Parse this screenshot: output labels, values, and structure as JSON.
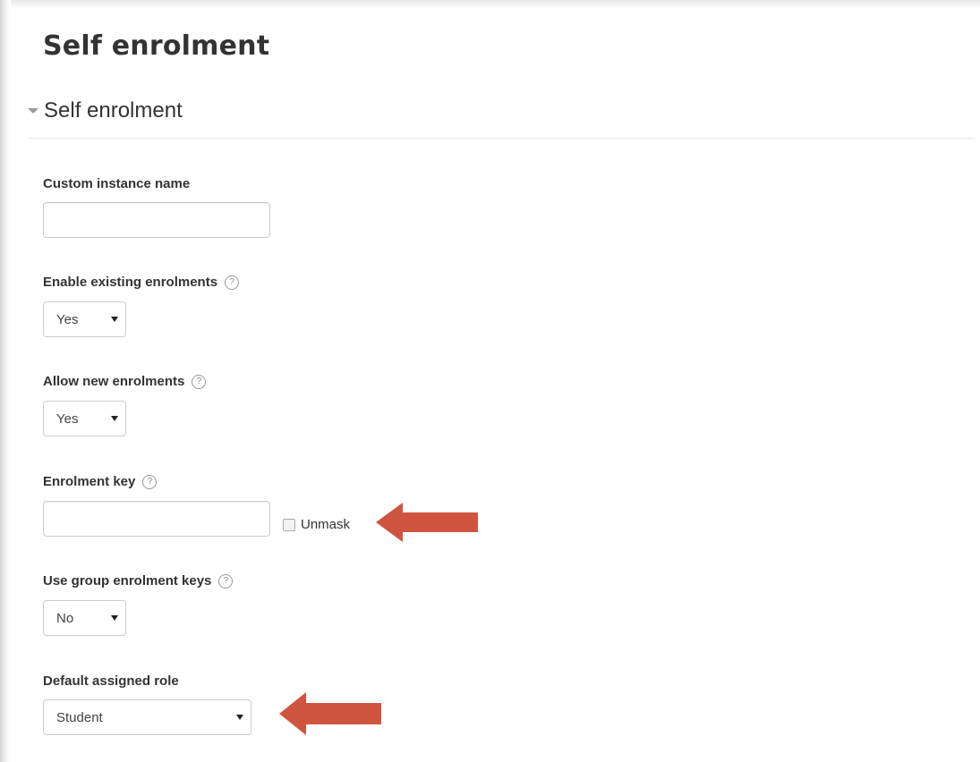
{
  "page": {
    "title": "Self enrolment"
  },
  "section": {
    "legend": "Self enrolment"
  },
  "fields": {
    "custom_instance_name": {
      "label": "Custom instance name",
      "value": ""
    },
    "enable_existing": {
      "label": "Enable existing enrolments",
      "value": "Yes"
    },
    "allow_new": {
      "label": "Allow new enrolments",
      "value": "Yes"
    },
    "enrolment_key": {
      "label": "Enrolment key",
      "value": "",
      "unmask_label": "Unmask"
    },
    "group_keys": {
      "label": "Use group enrolment keys",
      "value": "No"
    },
    "default_role": {
      "label": "Default assigned role",
      "value": "Student"
    }
  },
  "icons": {
    "help": "help-icon",
    "dropdown": "caret-down-icon",
    "collapse": "chevron-down-icon",
    "annotation": "arrow-left-icon"
  },
  "colors": {
    "annotation_arrow": "#d05540"
  }
}
